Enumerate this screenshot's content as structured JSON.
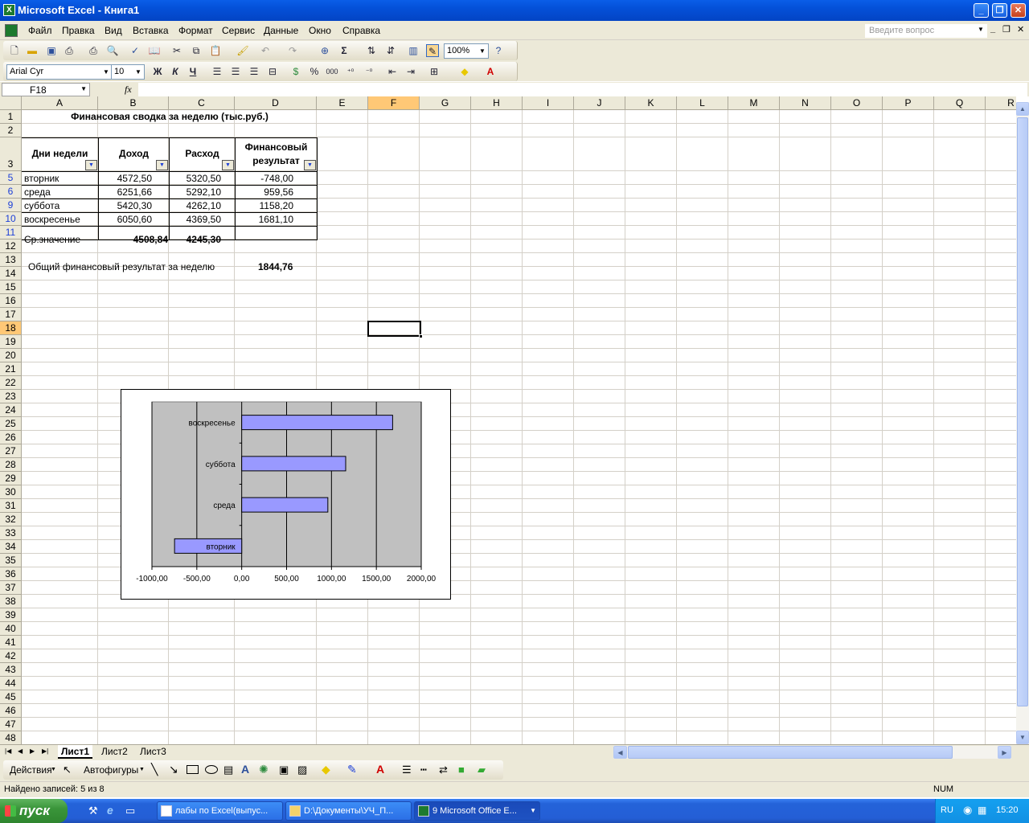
{
  "window": {
    "title": "Microsoft Excel - Книга1"
  },
  "menu": {
    "items": [
      "Файл",
      "Правка",
      "Вид",
      "Вставка",
      "Формат",
      "Сервис",
      "Данные",
      "Окно",
      "Справка"
    ],
    "help_placeholder": "Введите вопрос"
  },
  "toolbar": {
    "zoom": "100%",
    "font": "Arial Cyr",
    "font_size": "10",
    "bold": "Ж",
    "italic": "К",
    "underline": "Ч",
    "sum": "Σ",
    "thousands": "000"
  },
  "formula_bar": {
    "name_box": "F18",
    "fx": "fx",
    "content": ""
  },
  "sheet": {
    "columns": [
      "A",
      "B",
      "C",
      "D",
      "E",
      "F",
      "G",
      "H",
      "I",
      "J",
      "K",
      "L",
      "M",
      "N",
      "O",
      "P",
      "Q",
      "R"
    ],
    "rows": [
      "1",
      "2",
      "3",
      "5",
      "6",
      "9",
      "10",
      "11",
      "12",
      "13",
      "14",
      "15",
      "16",
      "17",
      "18",
      "19",
      "20",
      "21",
      "22",
      "23",
      "24",
      "25",
      "26",
      "27",
      "28",
      "29",
      "30",
      "31",
      "32",
      "33",
      "34",
      "35",
      "36",
      "37",
      "38",
      "39",
      "40",
      "41",
      "42",
      "43",
      "44",
      "45",
      "46",
      "47",
      "48"
    ],
    "title": "Финансовая сводка за неделю (тыс.руб.)",
    "headers": [
      "Дни недели",
      "Доход",
      "Расход",
      "Финансовый",
      "результат"
    ],
    "table": [
      [
        "вторник",
        "4572,50",
        "5320,50",
        "-748,00"
      ],
      [
        "среда",
        "6251,66",
        "5292,10",
        "959,56"
      ],
      [
        "суббота",
        "5420,30",
        "4262,10",
        "1158,20"
      ],
      [
        "воскресенье",
        "6050,60",
        "4369,50",
        "1681,10"
      ]
    ],
    "avg_label": "Ср.значение",
    "avg_income": "4508,84",
    "avg_expense": "4245,30",
    "total_label": "Общий финансовый результат за неделю",
    "total_value": "1844,76"
  },
  "chart_data": {
    "type": "bar",
    "orientation": "horizontal",
    "categories": [
      "вторник",
      "среда",
      "суббота",
      "воскресенье"
    ],
    "values": [
      -748.0,
      959.56,
      1158.2,
      1681.1
    ],
    "xlim": [
      -1000,
      2000
    ],
    "x_ticks": [
      "-1000,00",
      "-500,00",
      "0,00",
      "500,00",
      "1000,00",
      "1500,00",
      "2000,00"
    ],
    "grid": true,
    "plot_bg": "#c0c0c0",
    "bar_color": "#9999ff"
  },
  "tabs": [
    "Лист1",
    "Лист2",
    "Лист3"
  ],
  "drawing": {
    "actions": "Действия",
    "autoshapes": "Автофигуры"
  },
  "status": {
    "text": "Найдено записей: 5 из 8",
    "num": "NUM"
  },
  "taskbar": {
    "start": "пуск",
    "tasks": [
      "лабы по Excel(выпус...",
      "D:\\Документы\\УЧ_П...",
      "9 Microsoft Office E..."
    ],
    "lang": "RU",
    "clock": "15:20"
  }
}
